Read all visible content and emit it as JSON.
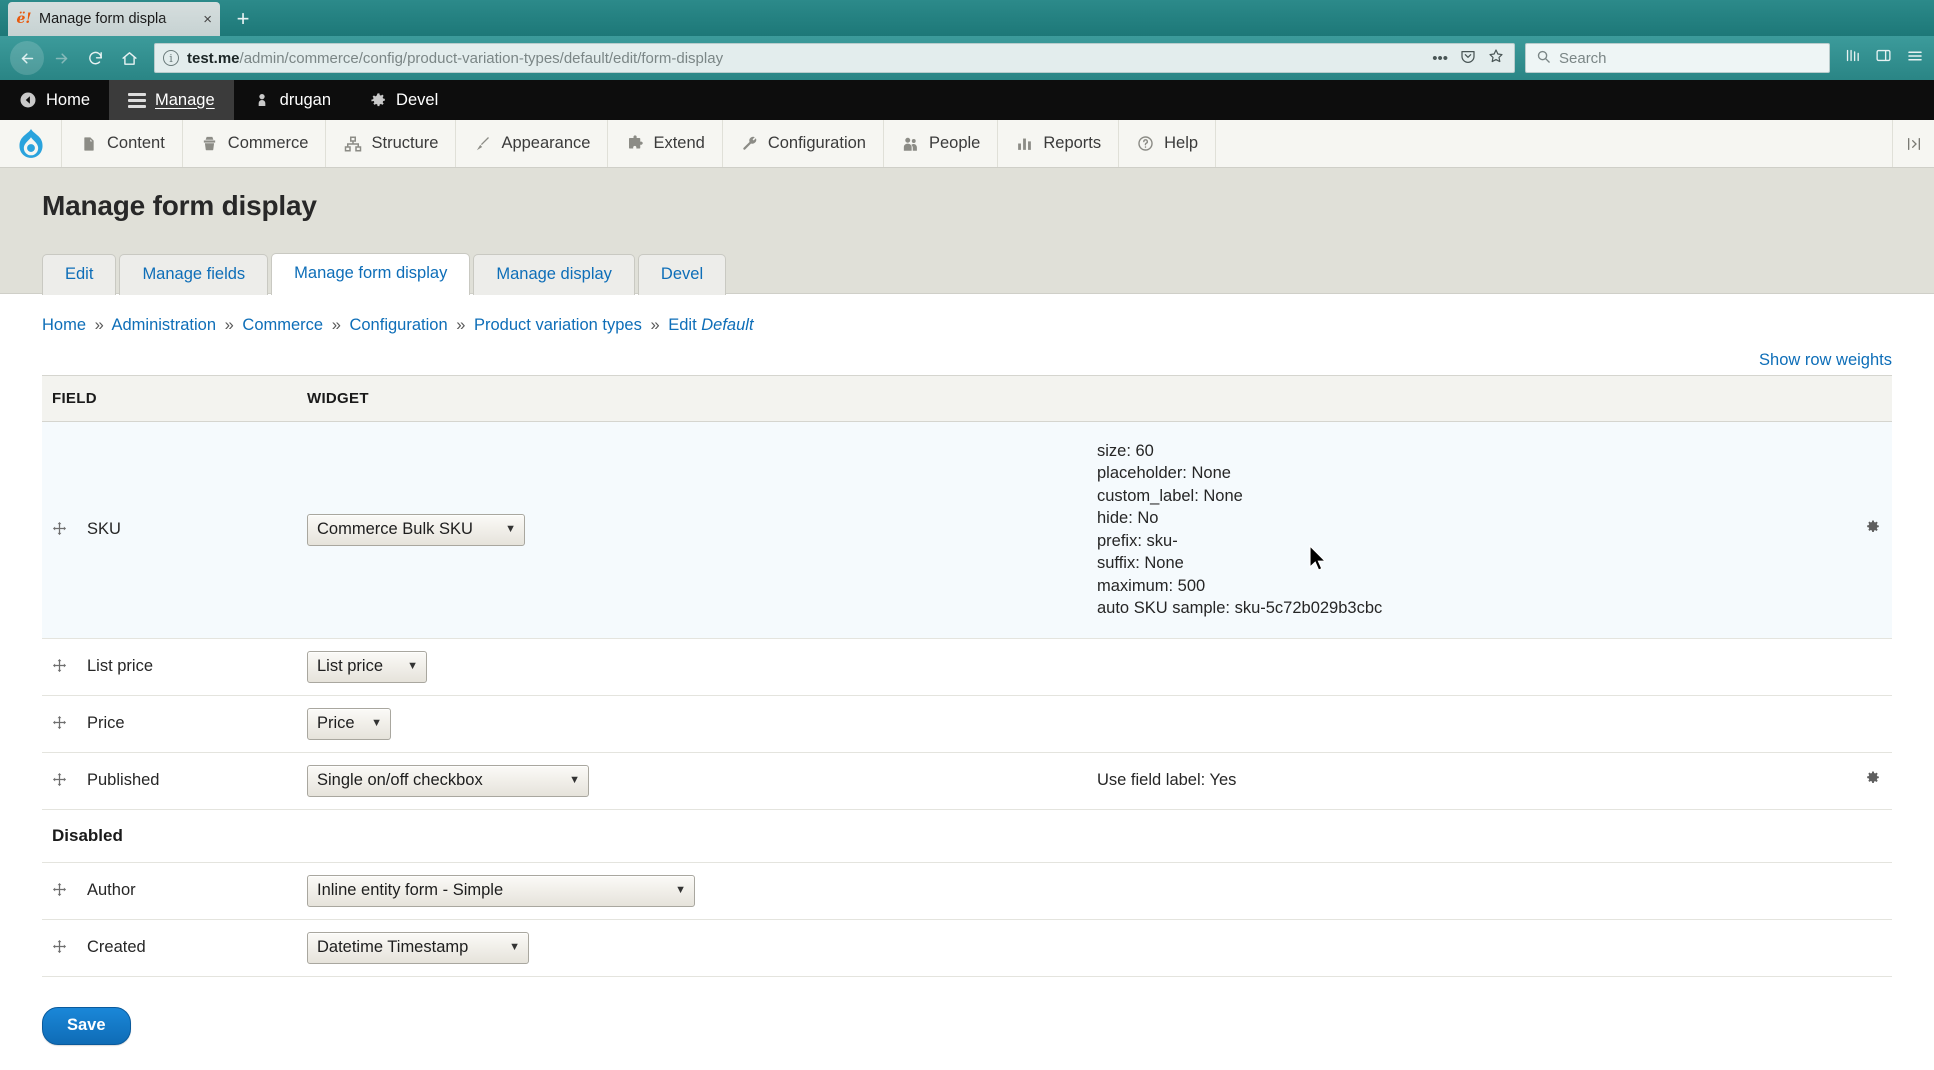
{
  "browser": {
    "tab": {
      "favicon": "drupal-favicon",
      "title": "Manage form displa",
      "close_label": "×"
    },
    "new_tab_label": "+",
    "nav": {
      "back": "←",
      "forward": "→",
      "reload": "⟳",
      "home": "⌂"
    },
    "url": {
      "info_icon": "i",
      "domain": "test.me",
      "path": "/admin/commerce/config/product-variation-types/default/edit/form-display",
      "actions_label": "•••",
      "pocket_icon": "pocket-icon",
      "bookmark_icon": "star-icon"
    },
    "search": {
      "icon": "search-icon",
      "placeholder": "Search",
      "value": "Search"
    },
    "right_icons": [
      "library-icon",
      "sidebar-icon",
      "menu-icon"
    ]
  },
  "admin_toolbar": {
    "items": [
      {
        "label": "Home",
        "icon": "drupal-home-icon",
        "active": false
      },
      {
        "label": "Manage",
        "icon": "hamburger-icon",
        "active": true
      },
      {
        "label": "drugan",
        "icon": "user-icon",
        "active": false
      },
      {
        "label": "Devel",
        "icon": "gear-icon",
        "active": false
      }
    ]
  },
  "admin_menu": {
    "logo": "drupal-drop-logo",
    "items": [
      {
        "label": "Content",
        "icon": "file-icon"
      },
      {
        "label": "Commerce",
        "icon": "cart-icon"
      },
      {
        "label": "Structure",
        "icon": "structure-icon"
      },
      {
        "label": "Appearance",
        "icon": "brush-icon"
      },
      {
        "label": "Extend",
        "icon": "puzzle-icon"
      },
      {
        "label": "Configuration",
        "icon": "wrench-icon"
      },
      {
        "label": "People",
        "icon": "people-icon"
      },
      {
        "label": "Reports",
        "icon": "bars-icon"
      },
      {
        "label": "Help",
        "icon": "question-icon"
      }
    ],
    "collapse_icon": "collapse-icon"
  },
  "page": {
    "title": "Manage form display",
    "tabs": [
      {
        "label": "Edit",
        "active": false
      },
      {
        "label": "Manage fields",
        "active": false
      },
      {
        "label": "Manage form display",
        "active": true
      },
      {
        "label": "Manage display",
        "active": false
      },
      {
        "label": "Devel",
        "active": false
      }
    ],
    "breadcrumb": {
      "separator": "»",
      "items": [
        "Home",
        "Administration",
        "Commerce",
        "Configuration",
        "Product variation types"
      ],
      "current_prefix": "Edit",
      "current_emphasis": "Default"
    },
    "show_row_weights": "Show row weights"
  },
  "table": {
    "headers": {
      "field": "FIELD",
      "widget": "WIDGET",
      "summary": "",
      "settings": ""
    },
    "rows": [
      {
        "kind": "field",
        "highlight": true,
        "drag_icon": "drag-handle-icon",
        "label": "SKU",
        "widget": "Commerce Bulk SKU",
        "widget_width": "w-bulk",
        "summary_lines": [
          "size: 60",
          "placeholder: None",
          "custom_label: None",
          "hide: No",
          "prefix: sku-",
          "suffix: None",
          "maximum: 500",
          "auto SKU sample: sku-5c72b029b3cbc"
        ],
        "has_cog": true
      },
      {
        "kind": "field",
        "highlight": false,
        "drag_icon": "drag-handle-icon",
        "label": "List price",
        "widget": "List price",
        "widget_width": "w-list",
        "summary_lines": [],
        "has_cog": false
      },
      {
        "kind": "field",
        "highlight": false,
        "drag_icon": "drag-handle-icon",
        "label": "Price",
        "widget": "Price",
        "widget_width": "w-price",
        "summary_lines": [],
        "has_cog": false
      },
      {
        "kind": "field",
        "highlight": false,
        "drag_icon": "drag-handle-icon",
        "label": "Published",
        "widget": "Single on/off checkbox",
        "widget_width": "w-pub",
        "summary_lines": [
          "Use field label: Yes"
        ],
        "has_cog": true
      },
      {
        "kind": "region",
        "label": "Disabled"
      },
      {
        "kind": "field",
        "highlight": false,
        "drag_icon": "drag-handle-icon",
        "label": "Author",
        "widget": "Inline entity form - Simple",
        "widget_width": "w-author",
        "summary_lines": [],
        "has_cog": false
      },
      {
        "kind": "field",
        "highlight": false,
        "drag_icon": "drag-handle-icon",
        "label": "Created",
        "widget": "Datetime Timestamp",
        "widget_width": "w-created",
        "summary_lines": [],
        "has_cog": false
      }
    ]
  },
  "actions": {
    "save_label": "Save"
  },
  "colors": {
    "browser_accent": "#1d7c7c",
    "link": "#0e6eb8",
    "toolbar_bg": "#0d0d0d",
    "highlight_row": "#f5fafd",
    "primary_button": "#0f6cb6"
  }
}
